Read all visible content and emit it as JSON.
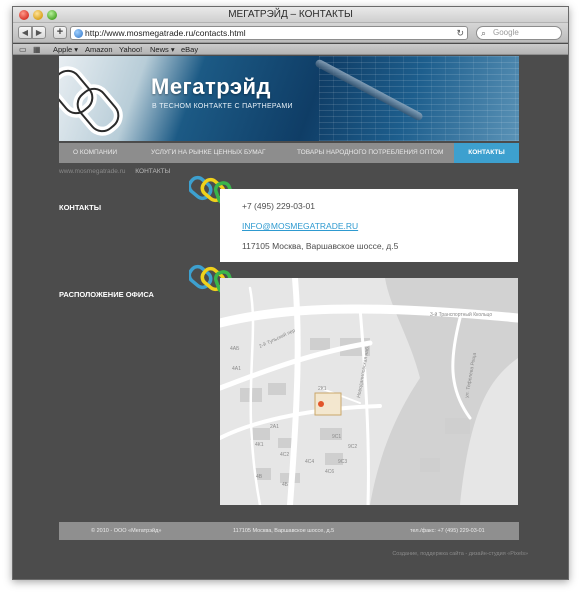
{
  "window": {
    "title": "МЕГАТРЭЙД – КОНТАКТЫ"
  },
  "toolbar": {
    "back_label": "◀",
    "forward_label": "▶",
    "add_label": "+",
    "url": "http://www.mosmegatrade.ru/contacts.html",
    "search_placeholder": "Google"
  },
  "bookmarks": {
    "items": [
      "Apple ▾",
      "Amazon",
      "Yahoo!",
      "News ▾",
      "eBay"
    ]
  },
  "site": {
    "brand_name": "Мегатрэйд",
    "tagline": "в тесном контакте с партнерами",
    "nav": [
      "О компании",
      "Услуги на рынке ценных бумаг",
      "Товары народного потребления оптом",
      "Контакты"
    ],
    "breadcrumb_home": "www.mosmegatrade.ru",
    "breadcrumb_current": "КОНТАКТЫ"
  },
  "contacts": {
    "section_title": "КОНТАКТЫ",
    "phone": "+7 (495) 229-03-01",
    "email": "INFO@MOSMEGATRADE.RU",
    "address": "117105 Москва, Варшавское шоссе, д.5"
  },
  "office": {
    "section_title": "РАСПОЛОЖЕНИЕ ОФИСА",
    "map_labels": [
      "3-й Транспортный Ккольцо",
      "2-й Тульский пер",
      "Новоданиловская наб.",
      "ул. Тефелева Роща",
      "4АБ",
      "4А1",
      "2А1",
      "4К1",
      "4С2",
      "4С4",
      "4С6",
      "2К1",
      "9С1",
      "9С2",
      "9С3",
      "4В",
      "4Б"
    ]
  },
  "footer": {
    "copyright": "© 2010 - ООО «Мегатрэйд»",
    "address": "117105 Москва, Варшавское шоссе, д.5",
    "phone": "тел./факс: +7 (495) 229-03-01",
    "credits": "Создание, поддержка сайта - дизайн-студия «Pixels»"
  },
  "colors": {
    "page_bg": "#4c4c4c",
    "nav_bg": "#8d8d8d",
    "nav_active": "#3da0cf",
    "link": "#2e9ad0"
  }
}
